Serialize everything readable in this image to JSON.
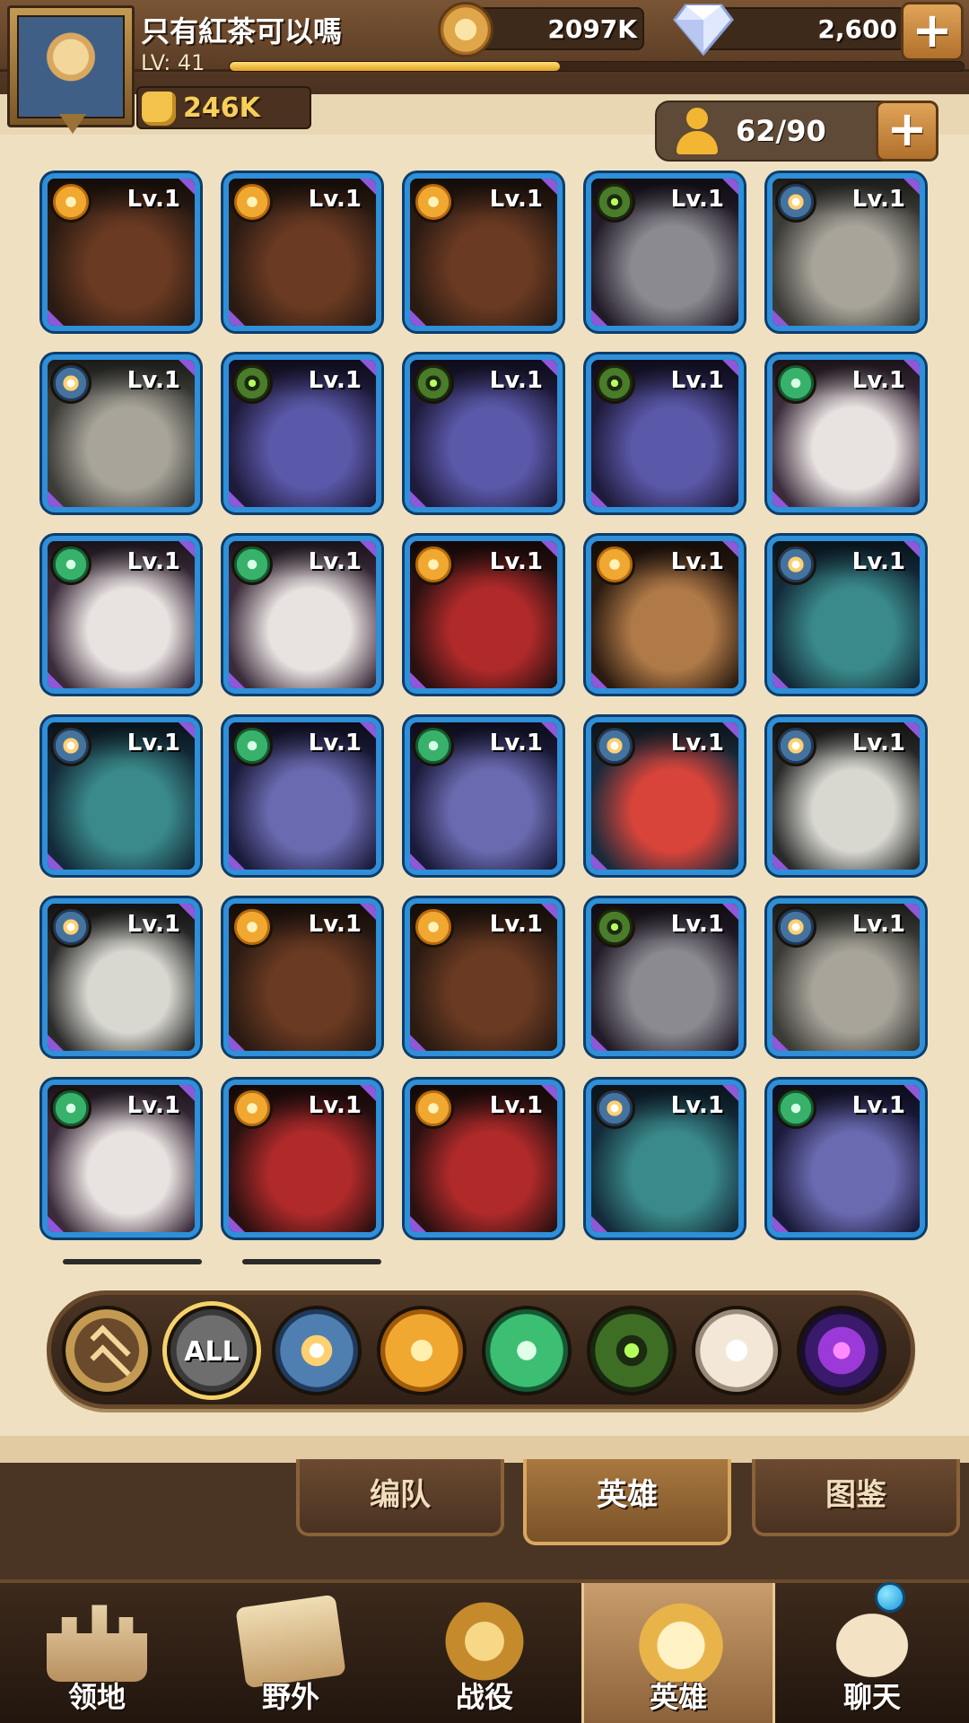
{
  "player": {
    "name": "只有紅茶可以嗎",
    "level_label": "LV:  41",
    "xp_progress": 0.45,
    "power": "246K"
  },
  "currencies": {
    "gold": "2097K",
    "gems": "2,600"
  },
  "hero_count": "62/90",
  "plus_symbol": "+",
  "heroes": [
    {
      "lv": "Lv.1",
      "faction": "gold",
      "portrait": "beast-warrior"
    },
    {
      "lv": "Lv.1",
      "faction": "gold",
      "portrait": "beast-warrior"
    },
    {
      "lv": "Lv.1",
      "faction": "gold",
      "portrait": "beast-warrior"
    },
    {
      "lv": "Lv.1",
      "faction": "eye",
      "portrait": "pale-assassin"
    },
    {
      "lv": "Lv.1",
      "faction": "blue",
      "portrait": "old-sage"
    },
    {
      "lv": "Lv.1",
      "faction": "blue",
      "portrait": "old-sage"
    },
    {
      "lv": "Lv.1",
      "faction": "eye",
      "portrait": "hooded-undead"
    },
    {
      "lv": "Lv.1",
      "faction": "eye",
      "portrait": "hooded-undead"
    },
    {
      "lv": "Lv.1",
      "faction": "eye",
      "portrait": "hooded-undead"
    },
    {
      "lv": "Lv.1",
      "faction": "green",
      "portrait": "white-beard-elf"
    },
    {
      "lv": "Lv.1",
      "faction": "green",
      "portrait": "white-beard-elf"
    },
    {
      "lv": "Lv.1",
      "faction": "green",
      "portrait": "white-beard-elf"
    },
    {
      "lv": "Lv.1",
      "faction": "gold",
      "portrait": "dark-sorceress"
    },
    {
      "lv": "Lv.1",
      "faction": "gold",
      "portrait": "tribal-warrior"
    },
    {
      "lv": "Lv.1",
      "faction": "blue",
      "portrait": "dwarf-hunter"
    },
    {
      "lv": "Lv.1",
      "faction": "blue",
      "portrait": "dwarf-hunter"
    },
    {
      "lv": "Lv.1",
      "faction": "green",
      "portrait": "shadow-elf"
    },
    {
      "lv": "Lv.1",
      "faction": "green",
      "portrait": "shadow-elf"
    },
    {
      "lv": "Lv.1",
      "faction": "blue",
      "portrait": "red-witch"
    },
    {
      "lv": "Lv.1",
      "faction": "blue",
      "portrait": "paladin"
    },
    {
      "lv": "Lv.1",
      "faction": "blue",
      "portrait": "paladin"
    },
    {
      "lv": "Lv.1",
      "faction": "gold",
      "portrait": "beast-warrior"
    },
    {
      "lv": "Lv.1",
      "faction": "gold",
      "portrait": "beast-warrior"
    },
    {
      "lv": "Lv.1",
      "faction": "eye",
      "portrait": "pale-assassin"
    },
    {
      "lv": "Lv.1",
      "faction": "blue",
      "portrait": "old-sage"
    },
    {
      "lv": "Lv.1",
      "faction": "green",
      "portrait": "white-beard-elf"
    },
    {
      "lv": "Lv.1",
      "faction": "gold",
      "portrait": "dark-sorceress"
    },
    {
      "lv": "Lv.1",
      "faction": "gold",
      "portrait": "dark-sorceress"
    },
    {
      "lv": "Lv.1",
      "faction": "blue",
      "portrait": "dwarf-hunter"
    },
    {
      "lv": "Lv.1",
      "faction": "green",
      "portrait": "shadow-elf"
    }
  ],
  "portrait_colors": {
    "beast-warrior": [
      "#6a3a22",
      "#2a1a12"
    ],
    "pale-assassin": [
      "#8a8a90",
      "#221a28"
    ],
    "old-sage": [
      "#a8a49a",
      "#3a3a36"
    ],
    "hooded-undead": [
      "#5a58a8",
      "#1e1a3a"
    ],
    "white-beard-elf": [
      "#e8e2e0",
      "#3a2a3a"
    ],
    "dark-sorceress": [
      "#b02a2a",
      "#2a1010"
    ],
    "tribal-warrior": [
      "#b07a48",
      "#2a1a10"
    ],
    "dwarf-hunter": [
      "#3a8a8a",
      "#132a3a"
    ],
    "shadow-elf": [
      "#6a6ab0",
      "#1a1a3a"
    ],
    "red-witch": [
      "#d8443a",
      "#1a2a3a"
    ],
    "paladin": [
      "#d8d8d0",
      "#2a2a2a"
    ]
  },
  "filters": [
    {
      "name": "rank-filter",
      "label": "",
      "active": false
    },
    {
      "name": "all-filter",
      "label": "ALL",
      "active": true
    },
    {
      "name": "lightbearer-filter",
      "label": "",
      "active": false
    },
    {
      "name": "maulers-filter",
      "label": "",
      "active": false
    },
    {
      "name": "wilder-filter",
      "label": "",
      "active": false
    },
    {
      "name": "graveborn-filter",
      "label": "",
      "active": false
    },
    {
      "name": "celestial-filter",
      "label": "",
      "active": false
    },
    {
      "name": "hypogean-filter",
      "label": "",
      "active": false
    }
  ],
  "subtabs": [
    {
      "label": "编队",
      "active": false
    },
    {
      "label": "英雄",
      "active": true
    },
    {
      "label": "图鉴",
      "active": false
    }
  ],
  "bottom_nav": [
    {
      "label": "领地",
      "icon": "castle-icon",
      "active": false
    },
    {
      "label": "野外",
      "icon": "scroll-map-icon",
      "active": false
    },
    {
      "label": "战役",
      "icon": "sword-shield-icon",
      "active": false
    },
    {
      "label": "英雄",
      "icon": "helmet-icon",
      "active": true
    },
    {
      "label": "聊天",
      "icon": "chat-bubble-icon",
      "active": false
    }
  ]
}
